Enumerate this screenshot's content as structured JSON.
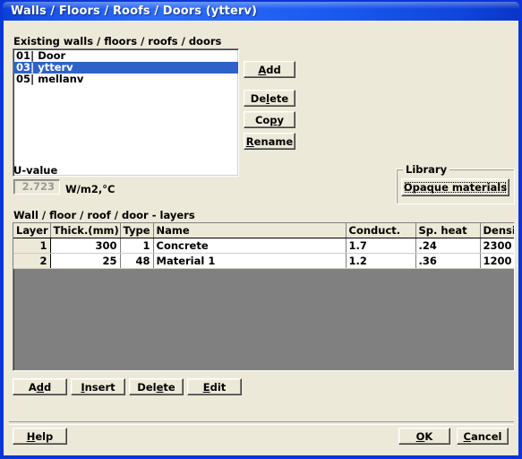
{
  "window": {
    "title": "Walls / Floors / Roofs / Doors (ytterv)"
  },
  "existing": {
    "label": "Existing walls / floors / roofs / doors",
    "items": [
      {
        "text": "01| Door",
        "selected": false
      },
      {
        "text": "03| ytterv",
        "selected": true
      },
      {
        "text": "05| mellanv",
        "selected": false
      }
    ],
    "buttons": [
      {
        "label": "Add",
        "pre": "",
        "key": "A",
        "post": "dd"
      },
      {
        "label": "Delete",
        "pre": "De",
        "key": "l",
        "post": "ete"
      },
      {
        "label": "Copy",
        "pre": "Co",
        "key": "p",
        "post": "y"
      },
      {
        "label": "Rename",
        "pre": "",
        "key": "R",
        "post": "ename"
      }
    ]
  },
  "uvalue": {
    "label": "U-value",
    "value": "2.723",
    "unit": "W/m2,°C"
  },
  "library": {
    "title": "Library",
    "button_label": "Opaque materials"
  },
  "layers": {
    "label": "Wall / floor / roof / door - layers",
    "columns": [
      "Layer",
      "Thick.(mm)",
      "Type",
      "Name",
      "Conduct.",
      "Sp. heat",
      "Density"
    ],
    "rows": [
      {
        "layer": "1",
        "thickness": "300",
        "type": "1",
        "name": "Concrete",
        "conduct": "1.7",
        "spheat": ".24",
        "density": "2300"
      },
      {
        "layer": "2",
        "thickness": "25",
        "type": "48",
        "name": "Material 1",
        "conduct": "1.2",
        "spheat": ".36",
        "density": "1200"
      }
    ],
    "buttons": [
      {
        "label": "Add",
        "pre": "A",
        "key": "d",
        "post": "d"
      },
      {
        "label": "Insert",
        "pre": "",
        "key": "I",
        "post": "nsert"
      },
      {
        "label": "Delete",
        "pre": "Del",
        "key": "e",
        "post": "te"
      },
      {
        "label": "Edit",
        "pre": "",
        "key": "E",
        "post": "dit"
      }
    ]
  },
  "footer": {
    "help": {
      "label": "Help",
      "pre": "",
      "key": "H",
      "post": "elp"
    },
    "ok": {
      "label": "OK",
      "pre": "",
      "key": "O",
      "post": "K"
    },
    "cancel": {
      "label": "Cancel",
      "pre": "",
      "key": "C",
      "post": "ancel"
    }
  },
  "colors": {
    "accent": "#2f62c8",
    "face": "#ece9d8",
    "grid_empty": "#808080",
    "title_blue": "#1651e8"
  }
}
